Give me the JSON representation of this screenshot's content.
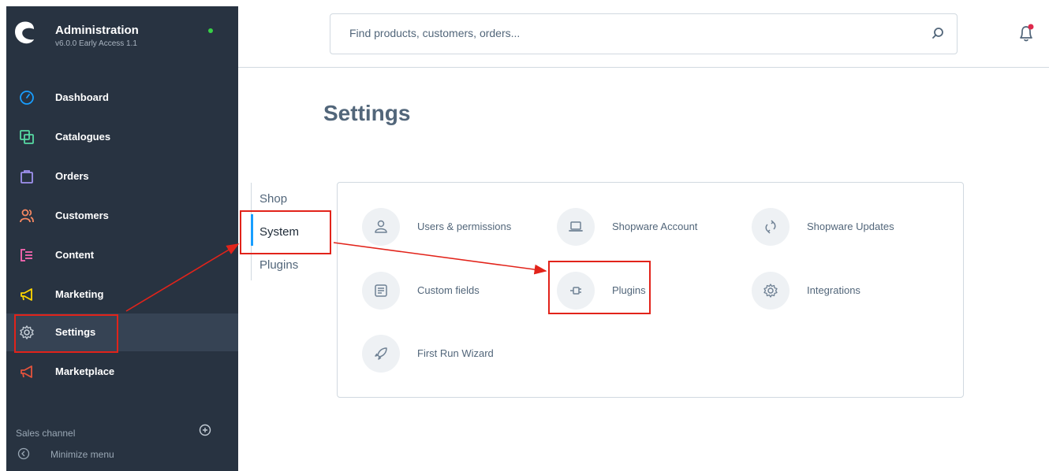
{
  "brand": {
    "title": "Administration",
    "version": "v6.0.0 Early Access 1.1"
  },
  "nav": [
    {
      "label": "Dashboard",
      "icon": "dashboard-icon",
      "color": "#189eff"
    },
    {
      "label": "Catalogues",
      "icon": "catalogues-icon",
      "color": "#57d9a3"
    },
    {
      "label": "Orders",
      "icon": "orders-icon",
      "color": "#a092f0"
    },
    {
      "label": "Customers",
      "icon": "customers-icon",
      "color": "#f88962"
    },
    {
      "label": "Content",
      "icon": "content-icon",
      "color": "#ff68b4"
    },
    {
      "label": "Marketing",
      "icon": "marketing-icon",
      "color": "#ffd700"
    },
    {
      "label": "Settings",
      "icon": "settings-icon",
      "color": "#9aa8b5",
      "active": true
    },
    {
      "label": "Marketplace",
      "icon": "marketplace-icon",
      "color": "#e5533c"
    }
  ],
  "sales_channel": {
    "label": "Sales channel"
  },
  "minimize": {
    "label": "Minimize menu"
  },
  "search": {
    "placeholder": "Find products, customers, orders..."
  },
  "page": {
    "title": "Settings"
  },
  "settings_tabs": [
    {
      "label": "Shop"
    },
    {
      "label": "System",
      "active": true
    },
    {
      "label": "Plugins"
    }
  ],
  "settings_items": [
    {
      "label": "Users & permissions",
      "icon": "user-icon"
    },
    {
      "label": "Shopware Account",
      "icon": "laptop-icon"
    },
    {
      "label": "Shopware Updates",
      "icon": "refresh-icon"
    },
    {
      "label": "Custom fields",
      "icon": "list-icon"
    },
    {
      "label": "Plugins",
      "icon": "plug-icon"
    },
    {
      "label": "Integrations",
      "icon": "gear-icon"
    },
    {
      "label": "First Run Wizard",
      "icon": "rocket-icon"
    }
  ],
  "colors": {
    "sidebar_bg": "#283341",
    "sidebar_active": "#364354",
    "accent": "#189eff",
    "annotation": "#e2231a",
    "online": "#37d046",
    "notification": "#de294c"
  }
}
